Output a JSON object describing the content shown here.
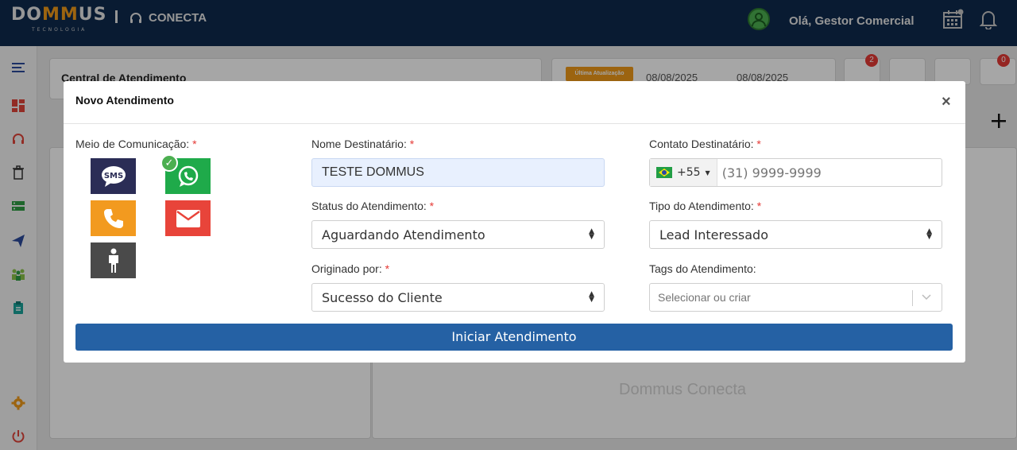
{
  "topbar": {
    "brand_prefix": "DO",
    "brand_highlight": "MM",
    "brand_suffix": "US",
    "brand_sub": "TECNOLOGIA",
    "product": "CONECTA",
    "greeting": "Olá, Gestor Comercial",
    "icons": [
      "headset-icon",
      "user-avatar-icon",
      "calendar-icon",
      "bell-icon"
    ]
  },
  "sidebar": {
    "icons": [
      "menu-icon",
      "dashboard-icon",
      "support-icon",
      "trash-icon",
      "server-icon",
      "send-icon",
      "team-icon",
      "clipboard-icon",
      "gear-icon",
      "power-icon"
    ]
  },
  "background": {
    "central_title": "Central de Atendimento",
    "last_update_badge": "Última Atualização",
    "date_from": "08/08/2025",
    "date_to": "08/08/2025",
    "search_badge": "2",
    "cart_badge": "0",
    "watermark": "Dommus Conecta"
  },
  "modal": {
    "title": "Novo Atendimento",
    "close_symbol": "×",
    "meio_label": "Meio de Comunicação:",
    "meio_options": [
      "SMS",
      "WhatsApp",
      "Telefone",
      "Email",
      "Presencial"
    ],
    "meio_selected": "WhatsApp",
    "sms_text": "SMS",
    "check_symbol": "✓",
    "required_mark": "*",
    "nome_label": "Nome Destinatário:",
    "nome_value": "TESTE DOMMUS",
    "contato_label": "Contato Destinatário:",
    "phone_country_code": "+55",
    "phone_placeholder": "(31) 9999-9999",
    "status_label": "Status do Atendimento:",
    "status_value": "Aguardando Atendimento",
    "tipo_label": "Tipo do Atendimento:",
    "tipo_value": "Lead Interessado",
    "origem_label": "Originado por:",
    "origem_value": "Sucesso do Cliente",
    "tags_label": "Tags do Atendimento:",
    "tags_placeholder": "Selecionar ou criar",
    "submit_label": "Iniciar Atendimento"
  },
  "colors": {
    "topbar": "#0e2a4d",
    "accent_orange": "#f09a1a",
    "primary_blue": "#2561a4",
    "sms": "#2b2d56",
    "whatsapp": "#1faa4a",
    "phone": "#f29a1f",
    "email": "#e8443a",
    "presencial": "#4a4a4a",
    "required": "#e53935"
  }
}
